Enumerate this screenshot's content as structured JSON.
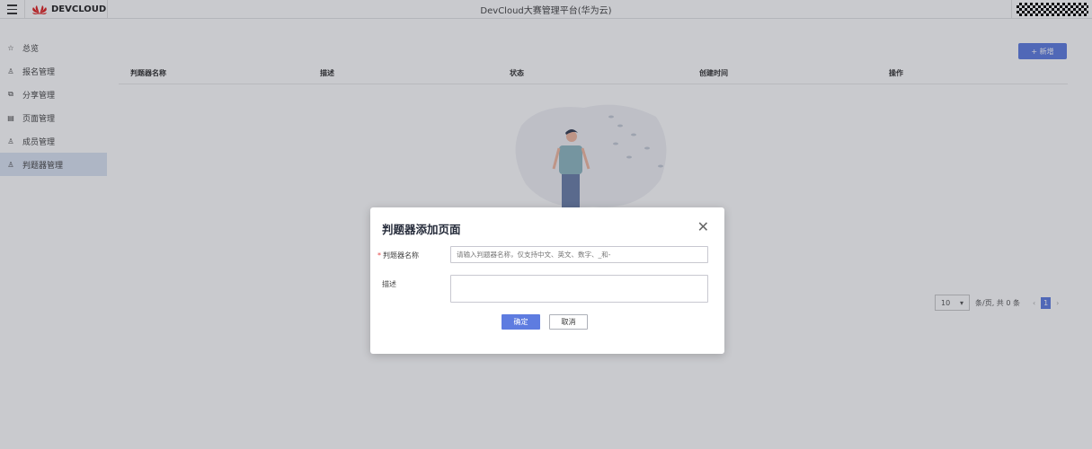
{
  "header": {
    "brand": "DEVCLOUD",
    "title": "DevCloud大赛管理平台(华为云)"
  },
  "sidebar": {
    "items": [
      {
        "label": "总览",
        "icon": "star-icon"
      },
      {
        "label": "报名管理",
        "icon": "user-icon"
      },
      {
        "label": "分享管理",
        "icon": "share-icon"
      },
      {
        "label": "页面管理",
        "icon": "page-icon"
      },
      {
        "label": "成员管理",
        "icon": "users-icon"
      },
      {
        "label": "判题器管理",
        "icon": "users-icon",
        "active": true
      }
    ]
  },
  "main": {
    "add_label": "+ 新增",
    "columns": [
      "判题器名称",
      "描述",
      "状态",
      "创建时间",
      "操作"
    ],
    "pager": {
      "page_size": "10",
      "summary": "条/页, 共 0 条",
      "current": "1"
    }
  },
  "dialog": {
    "title": "判题器添加页面",
    "name_label": "判题器名称",
    "name_required": "*",
    "name_placeholder": "请输入判题器名称，仅支持中文、英文、数字、_和-",
    "desc_label": "描述",
    "ok_label": "确定",
    "cancel_label": "取消"
  },
  "colors": {
    "accent": "#5e7ce0"
  }
}
